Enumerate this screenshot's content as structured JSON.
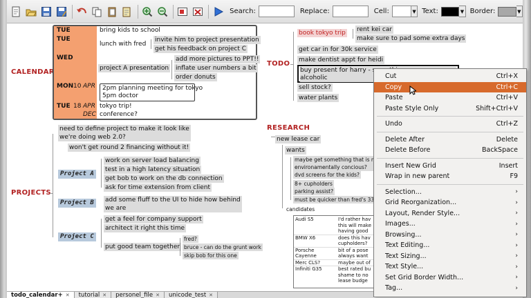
{
  "toolbar": {
    "search_label": "Search:",
    "search_value": "",
    "replace_label": "Replace:",
    "replace_value": "",
    "cell_label": "Cell:",
    "cell_value": "",
    "text_label": "Text:",
    "border_label": "Border:",
    "text_color": "#000000",
    "border_color": "#a8a8a8",
    "buttons": [
      "new-icon",
      "open-icon",
      "save-icon",
      "save-as-icon",
      "undo-icon",
      "copy-icon",
      "paste-icon",
      "paste-style-icon",
      "zoom-in-icon",
      "zoom-out-icon",
      "image-icon",
      "delete-image-icon",
      "run-icon"
    ]
  },
  "calendar": {
    "label": "CALENDAR",
    "days": [
      {
        "day": "TUE",
        "num": "",
        "month": "",
        "items": [
          "bring kids to school"
        ]
      },
      {
        "day": "TUE",
        "num": "",
        "month": "",
        "items": [
          "lunch with fred"
        ],
        "children": [
          "invite him to project presentation",
          "get his feedback on project C"
        ]
      },
      {
        "day": "WED",
        "num": "",
        "month": "",
        "items": [
          "project A presentation"
        ],
        "children": [
          "add more pictures to PPT!!",
          "inflate user numbers a bit",
          "order donuts"
        ]
      },
      {
        "day": "MON",
        "num": "10",
        "month": "APR",
        "items": [
          "2pm planning meeting for tokyo",
          "5pm doctor"
        ]
      },
      {
        "day": "TUE",
        "num": "18",
        "month": "APR",
        "items": [
          "tokyo trip!"
        ]
      },
      {
        "day": "",
        "num": "",
        "month": "DEC",
        "items": [
          "conference?"
        ]
      }
    ]
  },
  "projects": {
    "label": "PROJECTS",
    "intro": [
      "need to define project to make it look like",
      "we're doing web 2.0?"
    ],
    "intro_child": "won't get round 2 financing without it!",
    "a": {
      "label": "Project A",
      "items": [
        "work on server load balancing",
        "test in a high latency situation",
        "get bob to work on the db connection",
        "ask for time extension from client"
      ]
    },
    "b": {
      "label": "Project B",
      "items": [
        "add some fluff to the UI to hide how behind",
        "we are"
      ]
    },
    "c": {
      "label": "Project C",
      "items": [
        "get a feel for company support",
        "architect it right this time",
        "put good team together"
      ],
      "team": [
        "fred?",
        "bruce - can do the grunt work",
        "skip bob for this one"
      ]
    }
  },
  "todo": {
    "label": "TODO",
    "trip": "book tokyo trip",
    "trip_children": [
      "rent kei car",
      "make sure to pad some extra days"
    ],
    "items": [
      "get car in for 30k service",
      "make dentist appt for heidi",
      "buy present for harry - something",
      "alcoholic",
      "sell stock?",
      "water plants"
    ]
  },
  "research": {
    "label": "RESEARCH",
    "topic": "new lease car",
    "wants_label": "wants",
    "wants": [
      "maybe get something that is more",
      "environamentally concious?",
      "dvd screens for the kids?",
      "8+ cupholders",
      "parking assist?",
      "must be quicker than fred's 335"
    ],
    "candidates_label": "candidates",
    "candidates": [
      {
        "name": "Audi S5",
        "note": [
          "I'd rather hav",
          "this will make",
          "having good"
        ]
      },
      {
        "name": "BMW X6",
        "note": [
          "does this hav",
          "cupholders?"
        ]
      },
      {
        "name": "Porsche Cayenne",
        "note": [
          "bit of a pose",
          "always want"
        ]
      },
      {
        "name": "Merc CLS?",
        "note": [
          "maybe out of"
        ]
      },
      {
        "name": "Infiniti G35",
        "note": [
          "best rated bu",
          "shame to no",
          "lease budge"
        ]
      }
    ]
  },
  "context_menu": {
    "items": [
      {
        "label": "Cut",
        "shortcut": "Ctrl+X"
      },
      {
        "label": "Copy",
        "shortcut": "Ctrl+C"
      },
      {
        "label": "Paste",
        "shortcut": "Ctrl+V"
      },
      {
        "label": "Paste Style Only",
        "shortcut": "Shift+Ctrl+V"
      },
      {
        "label": "Undo",
        "shortcut": "Ctrl+Z"
      },
      {
        "label": "Delete After",
        "shortcut": "Delete"
      },
      {
        "label": "Delete Before",
        "shortcut": "BackSpace"
      },
      {
        "label": "Insert New Grid",
        "shortcut": "Insert"
      },
      {
        "label": "Wrap in new parent",
        "shortcut": "F9"
      },
      {
        "label": "Selection...",
        "shortcut": "›"
      },
      {
        "label": "Grid Reorganization...",
        "shortcut": "›"
      },
      {
        "label": "Layout, Render Style...",
        "shortcut": "›"
      },
      {
        "label": "Images...",
        "shortcut": "›"
      },
      {
        "label": "Browsing...",
        "shortcut": "›"
      },
      {
        "label": "Text Editing...",
        "shortcut": "›"
      },
      {
        "label": "Text Sizing...",
        "shortcut": "›"
      },
      {
        "label": "Text Style...",
        "shortcut": "›"
      },
      {
        "label": "Set Grid Border Width...",
        "shortcut": "›"
      },
      {
        "label": "Tag...",
        "shortcut": "›"
      }
    ]
  },
  "tabs": [
    "todo_calendar+",
    "tutorial",
    "personel_file",
    "unicode_test"
  ]
}
